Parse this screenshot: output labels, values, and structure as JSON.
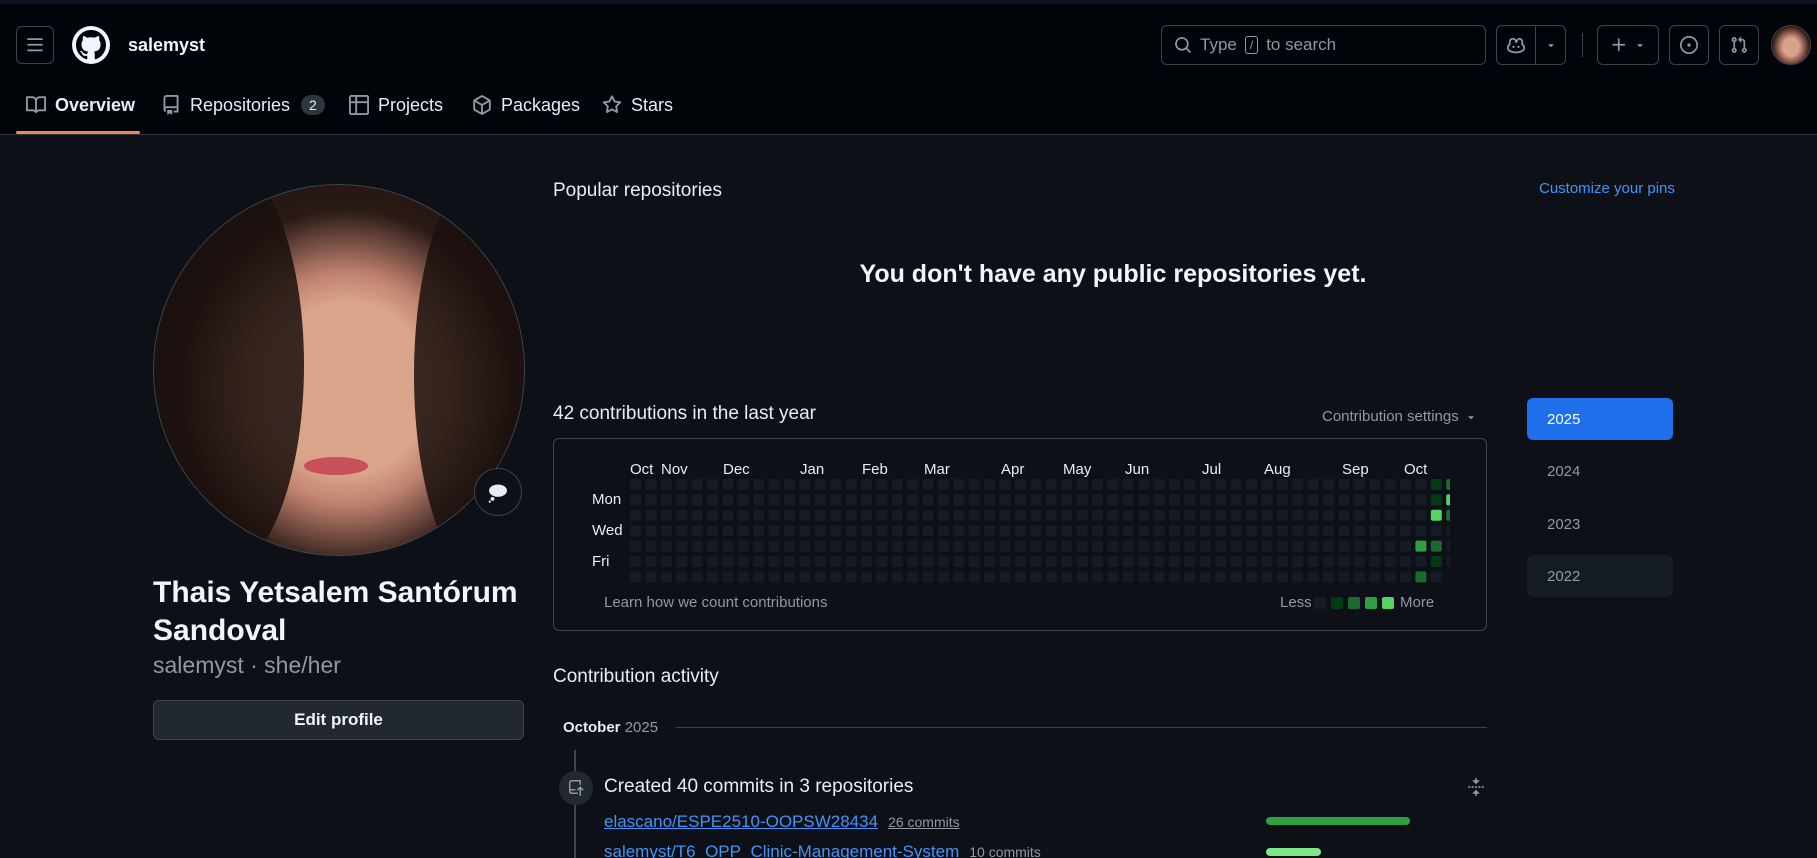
{
  "header": {
    "username": "salemyst",
    "search_prefix": "Type",
    "search_key": "/",
    "search_suffix": "to search"
  },
  "tabs": [
    {
      "label": "Overview",
      "selected": true
    },
    {
      "label": "Repositories",
      "count": "2"
    },
    {
      "label": "Projects"
    },
    {
      "label": "Packages"
    },
    {
      "label": "Stars"
    }
  ],
  "profile": {
    "full_name_line1": "Thais Yetsalem Santórum",
    "full_name_line2": "Sandoval",
    "handle": "salemyst · she/her",
    "edit_label": "Edit profile"
  },
  "popular": {
    "title": "Popular repositories",
    "customize": "Customize your pins",
    "empty_message": "You don't have any public repositories yet."
  },
  "contributions": {
    "title": "42 contributions in the last year",
    "settings_label": "Contribution settings",
    "months": [
      "Oct",
      "Nov",
      "Dec",
      "Jan",
      "Feb",
      "Mar",
      "Apr",
      "May",
      "Jun",
      "Jul",
      "Aug",
      "Sep",
      "Oct"
    ],
    "days": [
      "Mon",
      "Wed",
      "Fri"
    ],
    "learn_link": "Learn how we count contributions",
    "legend_less": "Less",
    "legend_more": "More",
    "active_cells": [
      {
        "week": 52,
        "day": 0,
        "level": 1
      },
      {
        "week": 53,
        "day": 0,
        "level": 2
      },
      {
        "week": 52,
        "day": 1,
        "level": 1
      },
      {
        "week": 53,
        "day": 1,
        "level": 4
      },
      {
        "week": 52,
        "day": 2,
        "level": 4
      },
      {
        "week": 53,
        "day": 2,
        "level": 2
      },
      {
        "week": 51,
        "day": 4,
        "level": 3
      },
      {
        "week": 52,
        "day": 4,
        "level": 2
      },
      {
        "week": 52,
        "day": 5,
        "level": 1
      },
      {
        "week": 51,
        "day": 6,
        "level": 2
      }
    ],
    "colors": {
      "level0": "#151b23",
      "level1": "#033a16",
      "level2": "#196c2e",
      "level3": "#2ea043",
      "level4": "#56d364"
    }
  },
  "years": [
    {
      "label": "2025",
      "selected": true
    },
    {
      "label": "2024"
    },
    {
      "label": "2023"
    },
    {
      "label": "2022",
      "hover": true
    }
  ],
  "activity": {
    "title": "Contribution activity",
    "month": "October",
    "year": "2025",
    "event_title": "Created 40 commits in 3 repositories",
    "repos": [
      {
        "name": "elascano/ESPE2510-OOPSW28434",
        "commits": "26 commits",
        "share": 0.65
      },
      {
        "name": "salemyst/T6_OPP_Clinic-Management-System",
        "commits": "10 commits",
        "share": 0.25
      }
    ]
  }
}
